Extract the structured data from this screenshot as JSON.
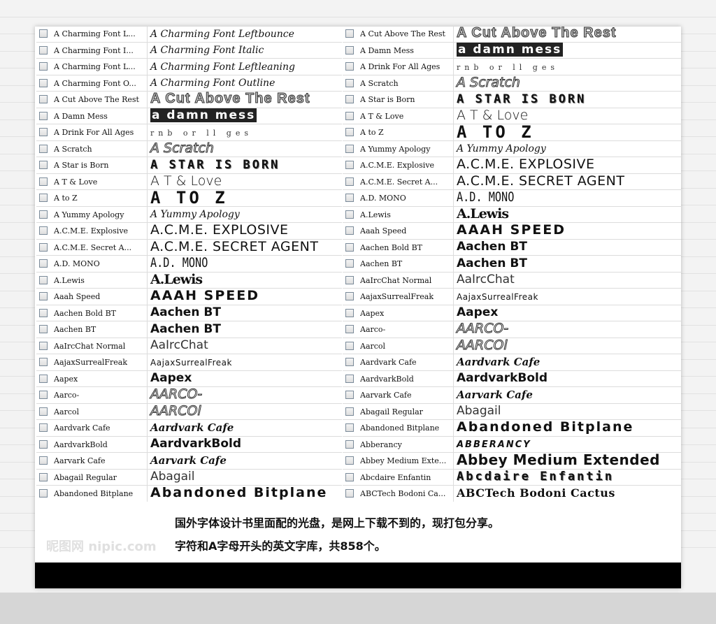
{
  "left_table": {
    "rows": [
      {
        "name": "A Charming Font L...",
        "sample": "A Charming Font Leftbounce",
        "style": "script"
      },
      {
        "name": "A Charming Font I...",
        "sample": "A Charming Font Italic",
        "style": "script"
      },
      {
        "name": "A Charming Font L...",
        "sample": "A Charming Font Leftleaning",
        "style": "script"
      },
      {
        "name": "A Charming Font O...",
        "sample": "A Charming Font Outline",
        "style": "script"
      },
      {
        "name": "A Cut Above The Rest",
        "sample": "A Cut Above The Rest",
        "style": "outline"
      },
      {
        "name": "A Damn Mess",
        "sample": "a damn mess",
        "style": "grunge"
      },
      {
        "name": "A Drink For All Ages",
        "sample": "rnb or ll ges",
        "style": "faint"
      },
      {
        "name": "A Scratch",
        "sample": "A Scratch",
        "style": "italic-outline"
      },
      {
        "name": "A Star is Born",
        "sample": "A STAR IS BORN",
        "style": "stencil"
      },
      {
        "name": "A T  & Love",
        "sample": "A T & Love",
        "style": "thin"
      },
      {
        "name": "A to Z",
        "sample": "A TO Z",
        "style": "pixel"
      },
      {
        "name": "A Yummy Apology",
        "sample": "A Yummy Apology",
        "style": "script"
      },
      {
        "name": "A.C.M.E. Explosive",
        "sample": "A.C.M.E. EXPLOSIVE",
        "style": "wide"
      },
      {
        "name": "A.C.M.E. Secret A...",
        "sample": "A.C.M.E. SECRET AGENT",
        "style": "wide"
      },
      {
        "name": "A.D. MONO",
        "sample": "A.D. MONO",
        "style": "mono"
      },
      {
        "name": "A.Lewis",
        "sample": "A.Lewis",
        "style": "blackletter"
      },
      {
        "name": "Aaah Speed",
        "sample": "AAAH SPEED",
        "style": "heavy"
      },
      {
        "name": "Aachen Bold BT",
        "sample": "Aachen BT",
        "style": "bold"
      },
      {
        "name": "Aachen BT",
        "sample": "Aachen BT",
        "style": "bold"
      },
      {
        "name": "AaIrcChat Normal",
        "sample": "AaIrcChat",
        "style": "light"
      },
      {
        "name": "AajaxSurrealFreak",
        "sample": "AajaxSurrealFreak",
        "style": "small"
      },
      {
        "name": "Aapex",
        "sample": "Aapex",
        "style": "bold"
      },
      {
        "name": "Aarco-",
        "sample": "AARCO-",
        "style": "italic-outline"
      },
      {
        "name": "Aarcol",
        "sample": "AARCOl",
        "style": "italic-outline"
      },
      {
        "name": "Aardvark Cafe",
        "sample": "Aardvark Cafe",
        "style": "italic-bold"
      },
      {
        "name": "AardvarkBold",
        "sample": "AardvarkBold",
        "style": "bold"
      },
      {
        "name": "Aarvark Cafe",
        "sample": "Aarvark Cafe",
        "style": "italic-bold"
      },
      {
        "name": "Abagail Regular",
        "sample": "Abagail",
        "style": "light"
      },
      {
        "name": "Abandoned Bitplane",
        "sample": "Abandoned Bitplane",
        "style": "heavy"
      }
    ]
  },
  "right_table": {
    "rows": [
      {
        "name": "A Cut Above The Rest",
        "sample": "A Cut Above The Rest",
        "style": "outline"
      },
      {
        "name": "A Damn Mess",
        "sample": "a damn mess",
        "style": "grunge"
      },
      {
        "name": "A Drink For All Ages",
        "sample": "rnb or ll ges",
        "style": "faint"
      },
      {
        "name": "A Scratch",
        "sample": "A Scratch",
        "style": "italic-outline"
      },
      {
        "name": "A Star is Born",
        "sample": "A STAR IS BORN",
        "style": "stencil"
      },
      {
        "name": "A T  & Love",
        "sample": "A T & Love",
        "style": "thin"
      },
      {
        "name": "A to Z",
        "sample": "A TO Z",
        "style": "pixel"
      },
      {
        "name": "A Yummy Apology",
        "sample": "A Yummy Apology",
        "style": "script"
      },
      {
        "name": "A.C.M.E. Explosive",
        "sample": "A.C.M.E. EXPLOSIVE",
        "style": "wide"
      },
      {
        "name": "A.C.M.E. Secret A...",
        "sample": "A.C.M.E. SECRET AGENT",
        "style": "wide"
      },
      {
        "name": "A.D. MONO",
        "sample": "A.D. MONO",
        "style": "mono"
      },
      {
        "name": "A.Lewis",
        "sample": "A.Lewis",
        "style": "blackletter"
      },
      {
        "name": "Aaah Speed",
        "sample": "AAAH SPEED",
        "style": "heavy"
      },
      {
        "name": "Aachen Bold BT",
        "sample": "Aachen BT",
        "style": "bold"
      },
      {
        "name": "Aachen BT",
        "sample": "Aachen BT",
        "style": "bold"
      },
      {
        "name": "AaIrcChat Normal",
        "sample": "AaIrcChat",
        "style": "light"
      },
      {
        "name": "AajaxSurrealFreak",
        "sample": "AajaxSurrealFreak",
        "style": "small"
      },
      {
        "name": "Aapex",
        "sample": "Aapex",
        "style": "bold"
      },
      {
        "name": "Aarco-",
        "sample": "AARCO-",
        "style": "italic-outline"
      },
      {
        "name": "Aarcol",
        "sample": "AARCOl",
        "style": "italic-outline"
      },
      {
        "name": "Aardvark Cafe",
        "sample": "Aardvark Cafe",
        "style": "italic-bold"
      },
      {
        "name": "AardvarkBold",
        "sample": "AardvarkBold",
        "style": "bold"
      },
      {
        "name": "Aarvark Cafe",
        "sample": "Aarvark Cafe",
        "style": "italic-bold"
      },
      {
        "name": "Abagail Regular",
        "sample": "Abagail",
        "style": "light"
      },
      {
        "name": "Abandoned Bitplane",
        "sample": "Abandoned Bitplane",
        "style": "heavy"
      },
      {
        "name": "Abberancy",
        "sample": "ABBERANCY",
        "style": "italic-caps"
      },
      {
        "name": "Abbey Medium Exte...",
        "sample": "Abbey Medium Extended",
        "style": "rounded"
      },
      {
        "name": "Abcdaire Enfantin",
        "sample": "Abcdaire Enfantin",
        "style": "stencil"
      },
      {
        "name": "ABCTech Bodoni Ca...",
        "sample": "ABCTech Bodoni Cactus",
        "style": "serif-bold"
      }
    ]
  },
  "caption": {
    "line1": "国外字体设计书里面配的光盘，是网上下载不到的，现打包分享。",
    "line2": "字符和A字母开头的英文字库，共858个。"
  },
  "watermark": "昵图网 nipic.com"
}
